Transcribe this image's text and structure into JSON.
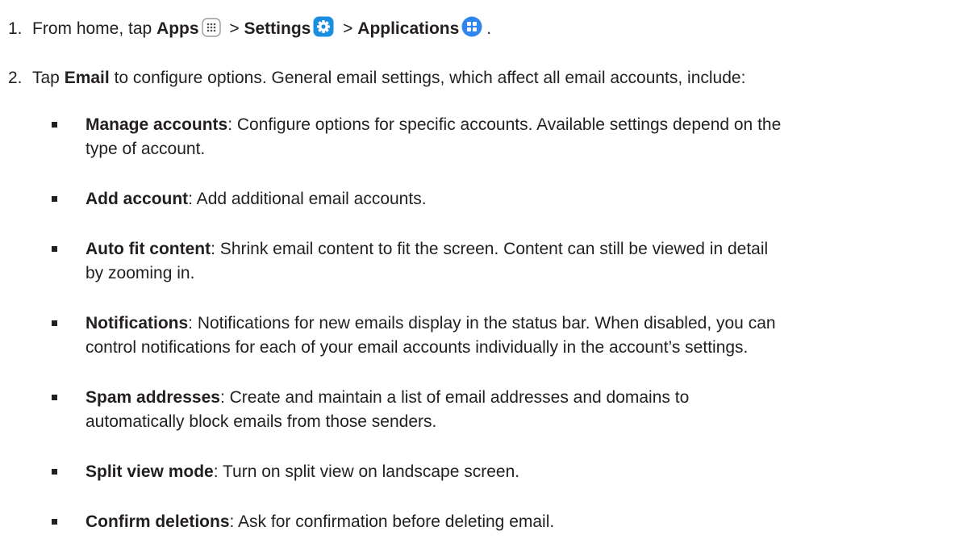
{
  "step1": {
    "number": "1.",
    "prefix": "From home, tap ",
    "apps": "Apps",
    "sep1": " > ",
    "settings": "Settings",
    "sep2": " > ",
    "applications": "Applications",
    "period": ".",
    "icons": [
      "apps-grid-icon",
      "gear-icon",
      "applications-grid-icon"
    ],
    "colors": {
      "settings_icon": "#1a8ee0",
      "applications_icon": "#2f86f0",
      "apps_icon_border": "#9a9a9a"
    }
  },
  "step2": {
    "number": "2.",
    "prefix": "Tap ",
    "email": "Email",
    "rest": " to configure options. General email settings, which affect all email accounts, include:"
  },
  "bullets": [
    {
      "term": "Manage accounts",
      "desc": ": Configure options for specific accounts. Available settings depend on the",
      "desc2": "type of account."
    },
    {
      "term": "Add account",
      "desc": ": Add additional email accounts.",
      "desc2": ""
    },
    {
      "term": "Auto fit content",
      "desc": ": Shrink email content to fit the screen. Content can still be viewed in detail",
      "desc2": "by zooming in."
    },
    {
      "term": "Notifications",
      "desc": ": Notifications for new emails display in the status bar. When disabled, you can",
      "desc2": "control notifications for each of your email accounts individually in the account’s settings."
    },
    {
      "term": "Spam addresses",
      "desc": ": Create and maintain a list of email addresses and domains to",
      "desc2": "automatically block emails from those senders."
    },
    {
      "term": "Split view mode",
      "desc": ": Turn on split view on landscape screen.",
      "desc2": ""
    },
    {
      "term": "Confirm deletions",
      "desc": ": Ask for confirmation before deleting email.",
      "desc2": ""
    }
  ]
}
